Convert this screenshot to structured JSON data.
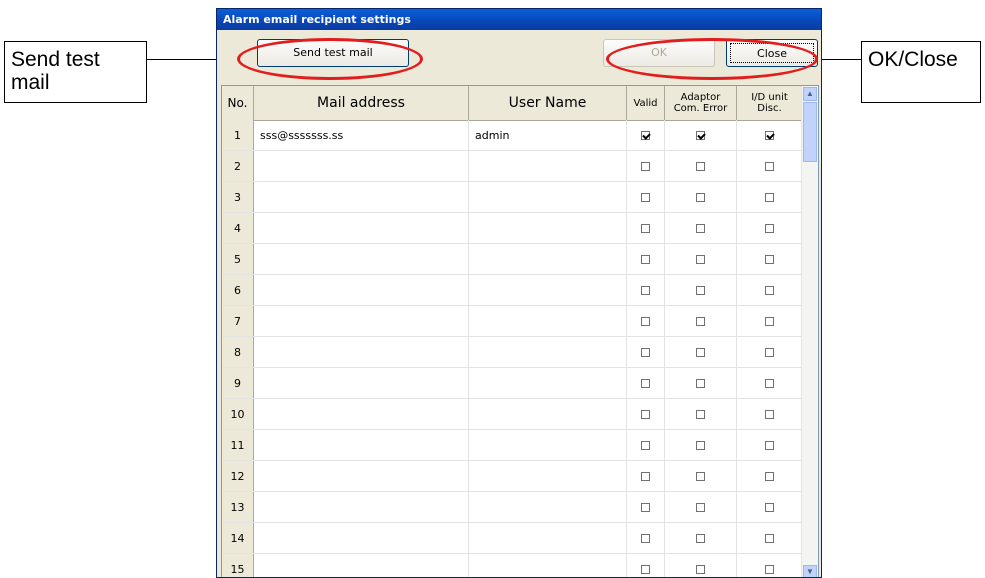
{
  "window": {
    "title": "Alarm email recipient settings"
  },
  "toolbar": {
    "send_label": "Send test mail",
    "ok_label": "OK",
    "close_label": "Close"
  },
  "callouts": {
    "left": "Send test\nmail",
    "right": "OK/Close"
  },
  "table": {
    "headers": {
      "no": "No.",
      "mail": "Mail address",
      "user": "User Name",
      "valid": "Valid",
      "adaptor": "Adaptor\nCom. Error",
      "idunit": "I/D unit\nDisc."
    },
    "rows": [
      {
        "no": "1",
        "mail": "sss@sssssss.ss",
        "user": "admin",
        "valid": true,
        "adaptor": true,
        "idunit": true
      },
      {
        "no": "2",
        "mail": "",
        "user": "",
        "valid": false,
        "adaptor": false,
        "idunit": false
      },
      {
        "no": "3",
        "mail": "",
        "user": "",
        "valid": false,
        "adaptor": false,
        "idunit": false
      },
      {
        "no": "4",
        "mail": "",
        "user": "",
        "valid": false,
        "adaptor": false,
        "idunit": false
      },
      {
        "no": "5",
        "mail": "",
        "user": "",
        "valid": false,
        "adaptor": false,
        "idunit": false
      },
      {
        "no": "6",
        "mail": "",
        "user": "",
        "valid": false,
        "adaptor": false,
        "idunit": false
      },
      {
        "no": "7",
        "mail": "",
        "user": "",
        "valid": false,
        "adaptor": false,
        "idunit": false
      },
      {
        "no": "8",
        "mail": "",
        "user": "",
        "valid": false,
        "adaptor": false,
        "idunit": false
      },
      {
        "no": "9",
        "mail": "",
        "user": "",
        "valid": false,
        "adaptor": false,
        "idunit": false
      },
      {
        "no": "10",
        "mail": "",
        "user": "",
        "valid": false,
        "adaptor": false,
        "idunit": false
      },
      {
        "no": "11",
        "mail": "",
        "user": "",
        "valid": false,
        "adaptor": false,
        "idunit": false
      },
      {
        "no": "12",
        "mail": "",
        "user": "",
        "valid": false,
        "adaptor": false,
        "idunit": false
      },
      {
        "no": "13",
        "mail": "",
        "user": "",
        "valid": false,
        "adaptor": false,
        "idunit": false
      },
      {
        "no": "14",
        "mail": "",
        "user": "",
        "valid": false,
        "adaptor": false,
        "idunit": false
      },
      {
        "no": "15",
        "mail": "",
        "user": "",
        "valid": false,
        "adaptor": false,
        "idunit": false
      }
    ]
  },
  "colors": {
    "highlight": "#e21d1d",
    "titlebar": "#0846b8"
  }
}
